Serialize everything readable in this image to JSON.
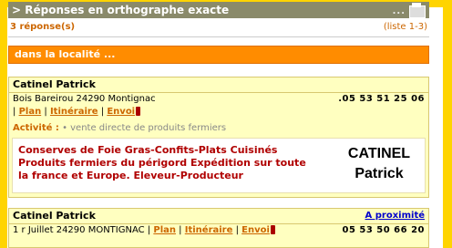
{
  "header": {
    "title": "> Réponses en orthographe exacte",
    "dots": "..."
  },
  "results": {
    "count": "3 réponse(s)",
    "range": "(liste 1-3)"
  },
  "locality_bar": "dans la localité ...",
  "listings": [
    {
      "name": "Catinel Patrick",
      "address": "Bois Bareirou 24290 Montignac",
      "phone": ".05 53 51 25 06",
      "links": {
        "plan": "Plan",
        "itinerary": "Itinéraire",
        "send": "Envoi",
        "sep": "|"
      },
      "activity_label": "Activité :",
      "activity_value": "• vente directe de produits fermiers",
      "ad_text": "Conserves de Foie Gras-Confits-Plats Cuisinés Produits fermiers du périgord Expédition sur toute la france et Europe. Eleveur-Producteur",
      "ad_logo_line1": "CATINEL",
      "ad_logo_line2": "Patrick"
    },
    {
      "name": "Catinel Patrick",
      "proximity": "A proximité",
      "address": "1 r Juillet 24290 MONTIGNAC",
      "phone": "05 53 50 66 20",
      "links": {
        "plan": "Plan",
        "itinerary": "Itinéraire",
        "send": "Envoi",
        "sep": "|"
      }
    }
  ]
}
